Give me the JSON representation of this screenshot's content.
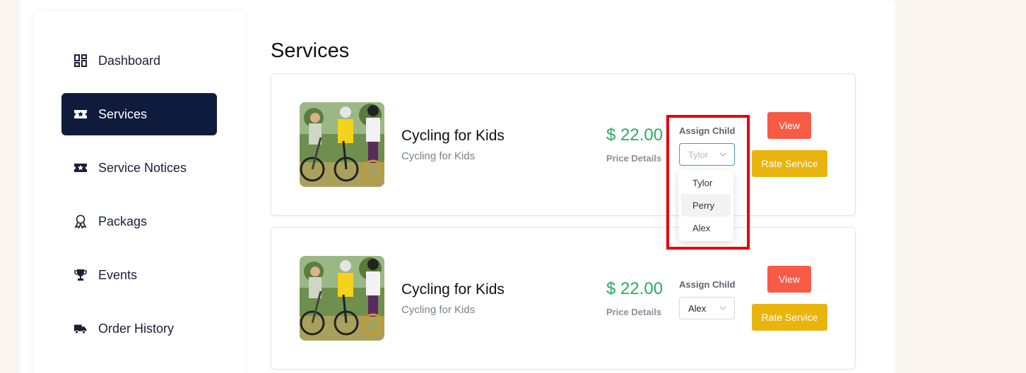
{
  "sidebar": {
    "items": [
      {
        "label": "Dashboard",
        "icon": "dashboard-icon",
        "active": false
      },
      {
        "label": "Services",
        "icon": "ticket-star-icon",
        "active": true
      },
      {
        "label": "Service Notices",
        "icon": "ticket-star-icon",
        "active": false
      },
      {
        "label": "Packags",
        "icon": "award-ribbon-icon",
        "active": false
      },
      {
        "label": "Events",
        "icon": "trophy-icon",
        "active": false
      },
      {
        "label": "Order History",
        "icon": "delivery-truck-icon",
        "active": false
      }
    ]
  },
  "main": {
    "title": "Services",
    "cards": [
      {
        "name": "Cycling for Kids",
        "subtitle": "Cycling for Kids",
        "price": "$ 22.00",
        "price_details": "Price Details",
        "assign_label": "Assign Child",
        "selected": "Tylor",
        "view_label": "View",
        "rate_label": "Rate Service"
      },
      {
        "name": "Cycling for Kids",
        "subtitle": "Cycling for Kids",
        "price": "$ 22.00",
        "price_details": "Price Details",
        "assign_label": "Assign Child",
        "selected": "Alex",
        "view_label": "View",
        "rate_label": "Rate Service"
      }
    ],
    "dropdown_options": [
      "Tylor",
      "Perry",
      "Alex"
    ],
    "dropdown_hovered": "Perry"
  },
  "colors": {
    "nav_active": "#0f1b3d",
    "price": "#27ae60",
    "view_button": "#f75a45",
    "rate_button": "#e9b40c",
    "highlight": "#e8000b",
    "page_bg": "#fbf6ef"
  }
}
